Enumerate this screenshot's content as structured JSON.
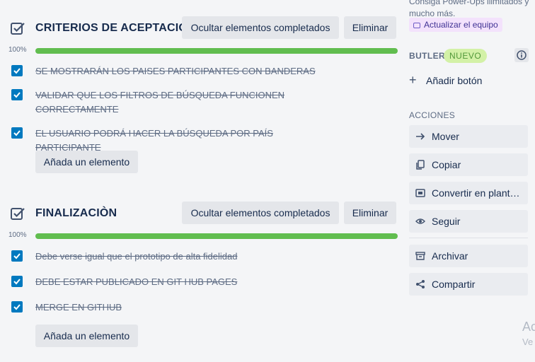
{
  "checklists": [
    {
      "title": "CRITERIOS DE ACEPTACIÓN",
      "hide_label": "Ocultar elementos completados",
      "delete_label": "Eliminar",
      "progress": 100,
      "progress_label": "100%",
      "items": [
        {
          "text": "SE MOSTRARÁN LOS PAISES PARTICIPANTES CON BANDERAS",
          "checked": true
        },
        {
          "text": "VALIDAR QUE LOS FILTROS DE BÚSQUEDA FUNCIONEN CORRECTAMENTE",
          "checked": true
        },
        {
          "text": "EL USUARIO PODRÁ HACER LA BÚSQUEDA POR PAÍS PARTICIPANTE",
          "checked": true
        }
      ],
      "add_label": "Añada un elemento"
    },
    {
      "title": "FINALIZACIÒN",
      "hide_label": "Ocultar elementos completados",
      "delete_label": "Eliminar",
      "progress": 100,
      "progress_label": "100%",
      "items": [
        {
          "text": "Debe verse igual que el prototipo de alta fidelidad",
          "checked": true
        },
        {
          "text": "DEBE ESTAR PUBLICADO EN GIT HUB PAGES",
          "checked": true
        },
        {
          "text": "MERGE EN GITHUB",
          "checked": true
        }
      ],
      "add_label": "Añada un elemento"
    }
  ],
  "sidebar": {
    "promo_text": "Consiga Power-Ups ilimitados y mucho más.",
    "upgrade_label": "Actualizar el equipo",
    "butler_label": "BUTLER",
    "new_badge": "NUEVO",
    "add_button_label": "Añadir botón",
    "actions_label": "ACCIONES",
    "actions": [
      {
        "label": "Mover",
        "icon": "arrow-right-icon"
      },
      {
        "label": "Copiar",
        "icon": "copy-icon"
      },
      {
        "label": "Convertir en plant…",
        "icon": "template-icon"
      },
      {
        "label": "Seguir",
        "icon": "eye-icon"
      },
      {
        "label": "Archivar",
        "icon": "archive-icon"
      },
      {
        "label": "Compartir",
        "icon": "share-icon"
      }
    ]
  },
  "watermark": {
    "line1": "Ac",
    "line2": "Ve"
  },
  "colors": {
    "progress": "#61bd4f",
    "checkbox": "#0079bf",
    "badge_bg": "#d3f1a7",
    "upgrade_bg": "#f3e2fc"
  }
}
